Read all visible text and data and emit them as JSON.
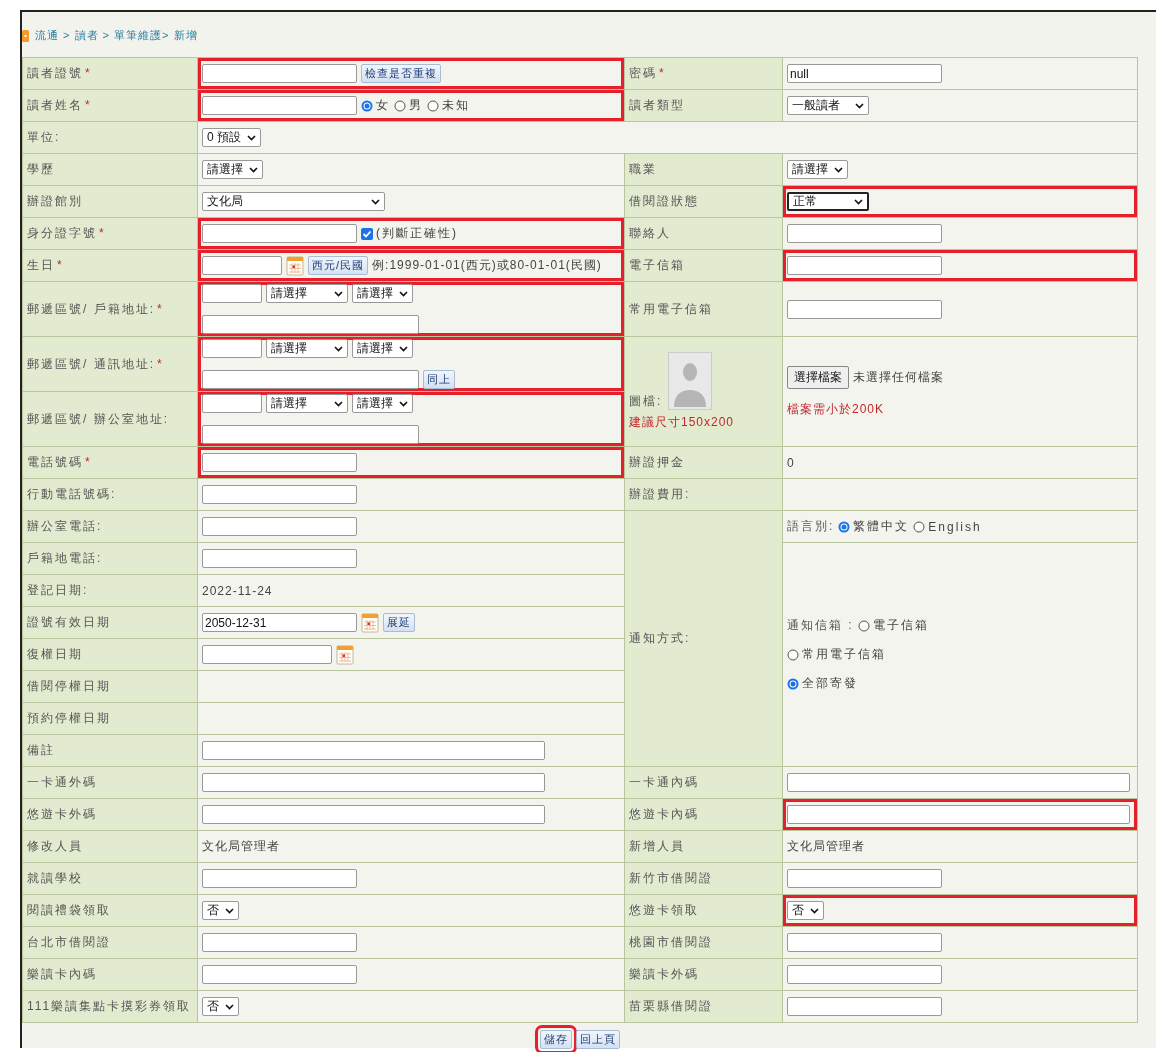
{
  "breadcrumb": "流通 > 讀者 > 單筆維護> 新增",
  "rows": [
    {
      "left_label": {
        "text": "讀者證號",
        "mark": "*"
      },
      "left_value": {
        "highlighted": true,
        "controls": [
          {
            "kind": "field"
          },
          {
            "kind": "button",
            "label": "檢查是否重複"
          }
        ]
      },
      "right_label": {
        "text": "密碼",
        "mark": "*"
      },
      "right_value": {
        "controls": [
          {
            "kind": "field",
            "value": "null"
          }
        ]
      }
    },
    {
      "left_label": {
        "text": "讀者姓名",
        "mark": "*"
      },
      "left_value": {
        "highlighted": true,
        "controls": [
          {
            "kind": "field"
          },
          {
            "kind": "radio",
            "label": "女",
            "selected": true
          },
          {
            "kind": "radio",
            "label": "男",
            "selected": false
          },
          {
            "kind": "radio",
            "label": "未知",
            "selected": false
          }
        ]
      },
      "right_label": {
        "text": "讀者類型"
      },
      "right_value": {
        "controls": [
          {
            "kind": "mid-select",
            "value": "一般讀者"
          }
        ]
      }
    },
    {
      "left_label": {
        "text": "單位:"
      },
      "left_value": {
        "full": true,
        "controls": [
          {
            "kind": "select",
            "value": "0 預設"
          }
        ]
      }
    },
    {
      "left_label": {
        "text": "學歷"
      },
      "left_value": {
        "controls": [
          {
            "kind": "select",
            "value": "請選擇"
          }
        ]
      },
      "right_label": {
        "text": "職業"
      },
      "right_value": {
        "controls": [
          {
            "kind": "select",
            "value": "請選擇"
          }
        ]
      }
    },
    {
      "left_label": {
        "text": "辦證館別"
      },
      "left_value": {
        "controls": [
          {
            "kind": "wide-select",
            "value": "文化局"
          }
        ]
      },
      "right_label": {
        "text": "借閱證狀態"
      },
      "right_value": {
        "highlighted": true,
        "controls": [
          {
            "kind": "mid-select",
            "value": "正常",
            "focused": true
          }
        ]
      }
    },
    {
      "left_label": {
        "text": "身分證字號",
        "mark": "*"
      },
      "left_value": {
        "highlighted": true,
        "controls": [
          {
            "kind": "field"
          },
          {
            "kind": "checkbox",
            "label": "(判斷正確性)",
            "checked": true
          }
        ]
      },
      "right_label": {
        "text": "聯絡人"
      },
      "right_value": {
        "controls": [
          {
            "kind": "field"
          }
        ]
      }
    },
    {
      "left_label": {
        "text": "生日",
        "mark": "*"
      },
      "left_value": {
        "highlighted": true,
        "controls": [
          {
            "kind": "date-field"
          },
          {
            "kind": "calendar"
          },
          {
            "kind": "button",
            "label": "西元/民國"
          },
          {
            "kind": "text",
            "text": "例:1999-01-01(西元)或80-01-01(民國)"
          }
        ]
      },
      "right_label": {
        "text": "電子信箱"
      },
      "right_value": {
        "highlighted": true,
        "controls": [
          {
            "kind": "field"
          }
        ]
      }
    },
    {
      "left_label": {
        "text": "郵遞區號/ 戶籍地址:",
        "mark": "*"
      },
      "left_value": {
        "highlighted": true,
        "controls": [
          {
            "kind": "zip-field"
          },
          {
            "kind": "mid-select",
            "value": "請選擇"
          },
          {
            "kind": "select",
            "value": "請選擇"
          },
          {
            "kind": "break"
          },
          {
            "kind": "address-field"
          }
        ]
      },
      "right_label": {
        "text": "常用電子信箱"
      },
      "right_value": {
        "controls": [
          {
            "kind": "field"
          }
        ]
      }
    },
    {
      "left_label": {
        "text": "郵遞區號/ 通訊地址:",
        "mark": "*"
      },
      "left_value": {
        "highlighted": true,
        "controls": [
          {
            "kind": "zip-field"
          },
          {
            "kind": "mid-select",
            "value": "請選擇"
          },
          {
            "kind": "select",
            "value": "請選擇"
          },
          {
            "kind": "break"
          },
          {
            "kind": "address-field"
          },
          {
            "kind": "button",
            "label": "同上"
          }
        ]
      },
      "right_label": {
        "text": "圖檔:",
        "photo": true,
        "note": "建議尺寸150x200"
      },
      "right_value": {
        "controls": [
          {
            "kind": "file",
            "label": "選擇檔案",
            "status": "未選擇任何檔案"
          },
          {
            "kind": "break"
          },
          {
            "kind": "note",
            "text": "檔案需小於200K"
          }
        ]
      }
    },
    {
      "left_label": {
        "text": "郵遞區號/ 辦公室地址:"
      },
      "left_value": {
        "highlighted": true,
        "controls": [
          {
            "kind": "zip-field"
          },
          {
            "kind": "mid-select",
            "value": "請選擇"
          },
          {
            "kind": "select",
            "value": "請選擇"
          },
          {
            "kind": "break"
          },
          {
            "kind": "address-field"
          }
        ]
      }
    },
    {
      "left_label": {
        "text": "電話號碼",
        "mark": "*"
      },
      "left_value": {
        "highlighted": true,
        "controls": [
          {
            "kind": "field"
          }
        ]
      },
      "right_label": {
        "text": "辦證押金"
      },
      "right_value": {
        "controls": [
          {
            "kind": "text",
            "text": "0"
          }
        ]
      }
    },
    {
      "left_label": {
        "text": "行動電話號碼:"
      },
      "left_value": {
        "controls": [
          {
            "kind": "field"
          }
        ]
      },
      "right_label": {
        "text": "辦證費用:"
      },
      "right_value": {}
    },
    {
      "left_label": {
        "text": "辦公室電話:"
      },
      "left_value": {
        "controls": [
          {
            "kind": "field"
          }
        ]
      },
      "right_label": {
        "text": "通知方式:"
      },
      "right_value": {
        "controls": [
          {
            "kind": "label",
            "text": "語言別:"
          },
          {
            "kind": "radio",
            "label": "繁體中文",
            "selected": true
          },
          {
            "kind": "radio",
            "label": "English",
            "selected": false
          }
        ]
      }
    },
    {
      "left_label": {
        "text": "戶籍地電話:"
      },
      "left_value": {
        "controls": [
          {
            "kind": "field"
          }
        ]
      },
      "right_value": {
        "controls": [
          {
            "kind": "label",
            "text": "通知信箱 :"
          },
          {
            "kind": "radio",
            "label": "電子信箱",
            "selected": false
          },
          {
            "kind": "break"
          },
          {
            "kind": "radio",
            "label": "常用電子信箱",
            "selected": false
          },
          {
            "kind": "break"
          },
          {
            "kind": "radio",
            "label": "全部寄發",
            "selected": true
          }
        ]
      }
    },
    {
      "left_label": {
        "text": "登記日期:"
      },
      "left_value": {
        "controls": [
          {
            "kind": "text",
            "text": "2022-11-24"
          }
        ]
      }
    },
    {
      "left_label": {
        "text": "證號有效日期"
      },
      "left_value": {
        "controls": [
          {
            "kind": "field",
            "value": "2050-12-31"
          },
          {
            "kind": "calendar"
          },
          {
            "kind": "button",
            "label": "展延"
          }
        ]
      }
    },
    {
      "left_label": {
        "text": "復權日期"
      },
      "left_value": {
        "controls": [
          {
            "kind": "mid-field"
          },
          {
            "kind": "calendar"
          }
        ]
      }
    },
    {
      "left_label": {
        "text": "借閱停權日期"
      },
      "left_value": {}
    },
    {
      "left_label": {
        "text": "預約停權日期"
      },
      "left_value": {}
    },
    {
      "left_label": {
        "text": "備註"
      },
      "left_value": {
        "controls": [
          {
            "kind": "wide-field"
          }
        ]
      }
    },
    {
      "left_label": {
        "text": "一卡通外碼"
      },
      "left_value": {
        "controls": [
          {
            "kind": "wide-field"
          }
        ]
      },
      "right_label": {
        "text": "一卡通內碼"
      },
      "right_value": {
        "controls": [
          {
            "kind": "wide-field"
          }
        ]
      }
    },
    {
      "left_label": {
        "text": "悠遊卡外碼"
      },
      "left_value": {
        "controls": [
          {
            "kind": "wide-field"
          }
        ]
      },
      "right_label": {
        "text": "悠遊卡內碼"
      },
      "right_value": {
        "highlighted": true,
        "controls": [
          {
            "kind": "wide-field"
          }
        ]
      }
    },
    {
      "left_label": {
        "text": "修改人員"
      },
      "left_value": {
        "controls": [
          {
            "kind": "text",
            "text": "文化局管理者"
          }
        ]
      },
      "right_label": {
        "text": "新增人員"
      },
      "right_value": {
        "controls": [
          {
            "kind": "text",
            "text": "文化局管理者"
          }
        ]
      }
    },
    {
      "left_label": {
        "text": "就讀學校"
      },
      "left_value": {
        "controls": [
          {
            "kind": "field"
          }
        ]
      },
      "right_label": {
        "text": "新竹市借閱證"
      },
      "right_value": {
        "controls": [
          {
            "kind": "field"
          }
        ]
      }
    },
    {
      "left_label": {
        "text": "閱讀禮袋領取"
      },
      "left_value": {
        "controls": [
          {
            "kind": "select",
            "value": "否"
          }
        ]
      },
      "right_label": {
        "text": "悠遊卡領取"
      },
      "right_value": {
        "highlighted": true,
        "controls": [
          {
            "kind": "select",
            "value": "否"
          }
        ]
      }
    },
    {
      "left_label": {
        "text": "台北市借閱證"
      },
      "left_value": {
        "controls": [
          {
            "kind": "field"
          }
        ]
      },
      "right_label": {
        "text": "桃園市借閱證"
      },
      "right_value": {
        "controls": [
          {
            "kind": "field"
          }
        ]
      }
    },
    {
      "left_label": {
        "text": "樂讀卡內碼"
      },
      "left_value": {
        "controls": [
          {
            "kind": "field"
          }
        ]
      },
      "right_label": {
        "text": "樂讀卡外碼"
      },
      "right_value": {
        "controls": [
          {
            "kind": "field"
          }
        ]
      }
    },
    {
      "left_label": {
        "text": "111樂讀集點卡摸彩券領取"
      },
      "left_value": {
        "controls": [
          {
            "kind": "select",
            "value": "否"
          }
        ]
      },
      "right_label": {
        "text": "苗栗縣借閱證"
      },
      "right_value": {
        "controls": [
          {
            "kind": "field"
          }
        ]
      }
    }
  ],
  "actions": [
    {
      "label": "儲存",
      "highlighted": true
    },
    {
      "label": "回上頁",
      "highlighted": false
    }
  ]
}
